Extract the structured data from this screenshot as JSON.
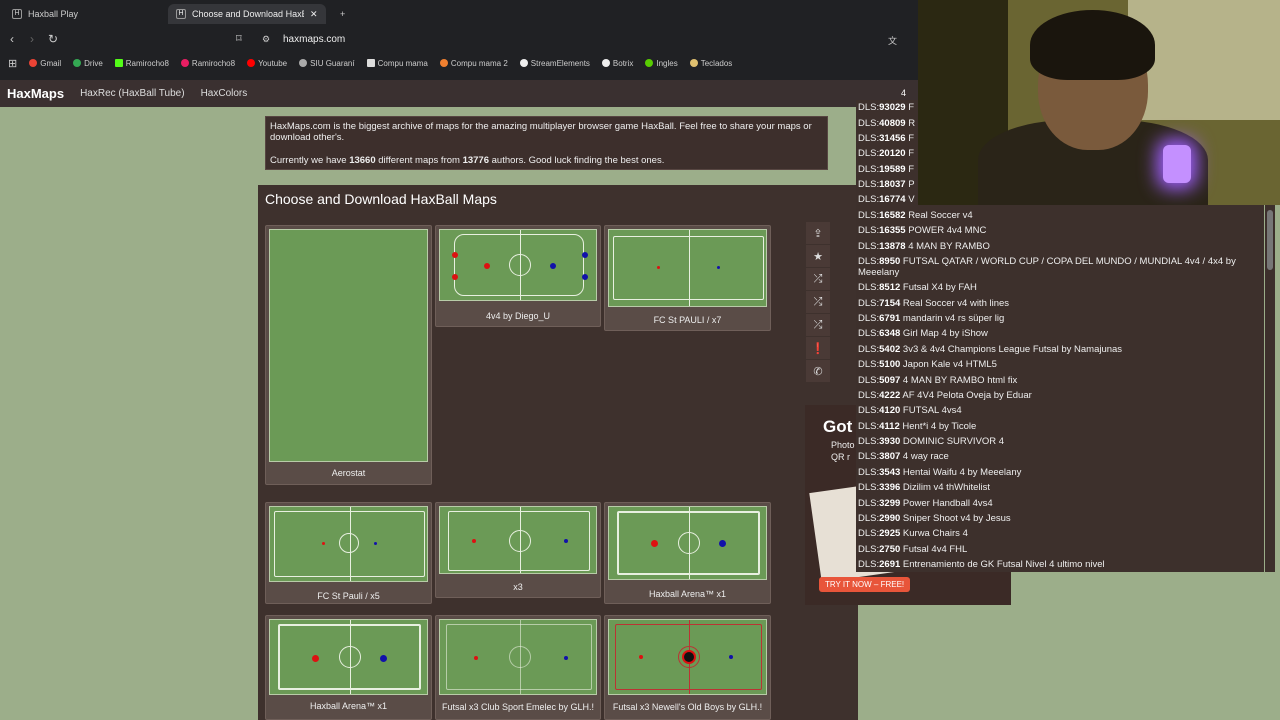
{
  "browser": {
    "tabs": [
      {
        "label": "Haxball Play"
      },
      {
        "label": "Choose and Download HaxBall M"
      }
    ],
    "new_tab_symbol": "+",
    "url": "haxmaps.com",
    "bookmarks": [
      "Gmail",
      "Drive",
      "Ramirocho8",
      "Ramirocho8",
      "Youtube",
      "SIU Guaraní",
      "Compu mama",
      "Compu mama 2",
      "StreamElements",
      "Botrix",
      "Ingles",
      "Teclados"
    ]
  },
  "site": {
    "logo": "HaxMaps",
    "nav": [
      "HaxRec (HaxBall Tube)",
      "HaxColors"
    ],
    "search_value": "4"
  },
  "intro": {
    "line1": "HaxMaps.com is the biggest archive of maps for the amazing multiplayer browser game HaxBall. Feel free to share your maps or download other's.",
    "line2_prefix": "Currently we have ",
    "maps_count": "13660",
    "line2_mid": " different maps from ",
    "authors_count": "13776",
    "line2_suffix": " authors. Good luck finding the best ones."
  },
  "main": {
    "title": "Choose and Download HaxBall Maps",
    "maps": [
      {
        "name": "Aerostat"
      },
      {
        "name": "4v4 by Diego_U"
      },
      {
        "name": "FC St PAULI / x7"
      },
      {
        "name": "FC St Pauli / x5"
      },
      {
        "name": "x3"
      },
      {
        "name": "Haxball Arena™ x1"
      },
      {
        "name": "Haxball Arena™ x1"
      },
      {
        "name": "Futsal x3 Club Sport Emelec by GLH.!"
      },
      {
        "name": "Futsal x3 Newell's Old Boys by GLH.!"
      }
    ]
  },
  "side_icons": [
    "upload-icon",
    "star-icon",
    "shuffle-icon",
    "shuffle-icon",
    "shuffle-icon",
    "comment-icon",
    "phone-icon"
  ],
  "ad": {
    "title": "Got",
    "sub1": "Photo",
    "sub2": "QR r",
    "button": "TRY IT NOW – FREE!"
  },
  "dropdown": {
    "prefix": "DLS:",
    "items": [
      {
        "dls": "93029",
        "name": "F"
      },
      {
        "dls": "40809",
        "name": "R"
      },
      {
        "dls": "31456",
        "name": "F"
      },
      {
        "dls": "20120",
        "name": "F"
      },
      {
        "dls": "19589",
        "name": "F"
      },
      {
        "dls": "18037",
        "name": "P"
      },
      {
        "dls": "16774",
        "name": "V"
      },
      {
        "dls": "16582",
        "name": "Real Soccer v4"
      },
      {
        "dls": "16355",
        "name": "POWER 4v4 MNC"
      },
      {
        "dls": "13878",
        "name": "4 MAN BY RAMBO"
      },
      {
        "dls": "8950",
        "name": "FUTSAL QATAR / WORLD CUP / COPA DEL MUNDO / MUNDIAL 4v4 / 4x4 by Meeelany"
      },
      {
        "dls": "8512",
        "name": "Futsal X4 by FAH"
      },
      {
        "dls": "7154",
        "name": "Real Soccer v4 with lines"
      },
      {
        "dls": "6791",
        "name": "mandarin v4 rs süper lig"
      },
      {
        "dls": "6348",
        "name": "Girl Map 4 by iShow"
      },
      {
        "dls": "5402",
        "name": "3v3 & 4v4 Champions League Futsal by Namajunas"
      },
      {
        "dls": "5100",
        "name": "Japon Kale v4 HTML5"
      },
      {
        "dls": "5097",
        "name": "4 MAN BY RAMBO html fix"
      },
      {
        "dls": "4222",
        "name": "AF 4V4 Pelota Oveja by Eduar"
      },
      {
        "dls": "4120",
        "name": "FUTSAL 4vs4"
      },
      {
        "dls": "4112",
        "name": "Hent*i 4 by Ticole"
      },
      {
        "dls": "3930",
        "name": "DOMINIC SURVIVOR 4"
      },
      {
        "dls": "3807",
        "name": "4 way race"
      },
      {
        "dls": "3543",
        "name": "Hentai Waifu 4 by Meeelany"
      },
      {
        "dls": "3396",
        "name": "Dizilim v4 thWhitelist"
      },
      {
        "dls": "3299",
        "name": "Power Handball 4vs4"
      },
      {
        "dls": "2990",
        "name": "Sniper Shoot v4 by Jesus"
      },
      {
        "dls": "2925",
        "name": "Kurwa Chairs 4"
      },
      {
        "dls": "2750",
        "name": "Futsal 4v4 FHL"
      },
      {
        "dls": "2691",
        "name": "Entrenamiento de GK Futsal Nivel 4 ultimo nivel"
      }
    ]
  },
  "colors": {
    "accent_red": "#dd1111",
    "accent_blue": "#1111aa",
    "pitch_green": "#6b9a56",
    "page_brown": "#3e312d"
  }
}
